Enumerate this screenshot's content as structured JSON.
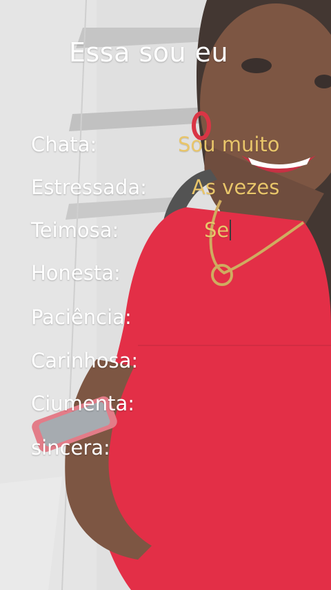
{
  "story": {
    "title": "Essa sou eu",
    "rows": [
      {
        "label": "Chata:",
        "answer": "Sou muito"
      },
      {
        "label": "Estressada:",
        "answer": "As vezes"
      },
      {
        "label": "Teimosa:",
        "answer": "Se"
      },
      {
        "label": "Honesta:",
        "answer": ""
      },
      {
        "label": "Paciência:",
        "answer": ""
      },
      {
        "label": "Carinhosa:",
        "answer": ""
      },
      {
        "label": "Ciumenta:",
        "answer": ""
      },
      {
        "label": "sincera:",
        "answer": ""
      }
    ]
  },
  "colors": {
    "label_text": "#ffffff",
    "answer_text": "#e8c56a",
    "dress": "#e0132e"
  }
}
